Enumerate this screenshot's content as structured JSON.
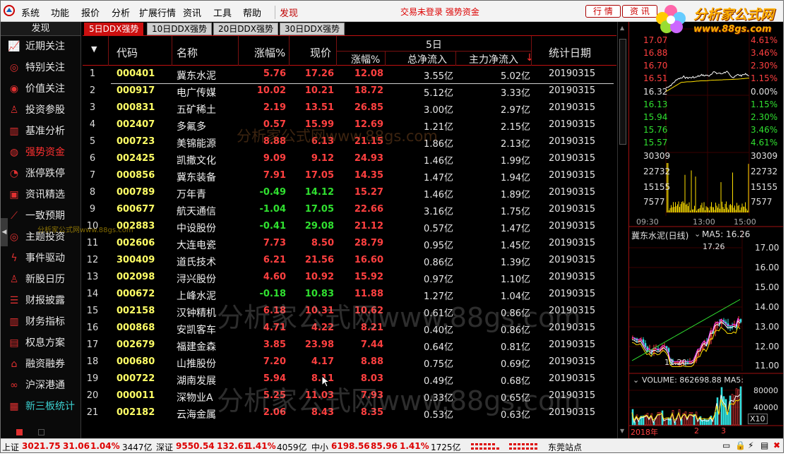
{
  "menubar": {
    "items": [
      "系统",
      "功能",
      "报价",
      "分析",
      "扩展行情",
      "资讯",
      "工具",
      "帮助"
    ],
    "discover": "发现",
    "status": "交易未登录  强势资金",
    "btn_quotes": "行 情",
    "btn_news": "资 讯",
    "logo_line1": "分析家公式网",
    "logo_line2": "www.88gs.com"
  },
  "sidebar": {
    "header": "发现",
    "items": [
      {
        "label": "近期关注",
        "icon": "trend-icon"
      },
      {
        "label": "特别关注",
        "icon": "target-icon"
      },
      {
        "label": "价值关注",
        "icon": "coins-icon"
      },
      {
        "label": "投资参股",
        "icon": "person-icon"
      },
      {
        "label": "基准分析",
        "icon": "bar-chart-icon"
      },
      {
        "label": "强势资金",
        "icon": "money-icon"
      },
      {
        "label": "涨停跌停",
        "icon": "pie-icon"
      },
      {
        "label": "资讯精选",
        "icon": "news-icon"
      },
      {
        "label": "一致预期",
        "icon": "line-chart-icon"
      },
      {
        "label": "主题投资",
        "icon": "target-icon"
      },
      {
        "label": "事件驱动",
        "icon": "lightning-icon"
      },
      {
        "label": "新股日历",
        "icon": "person-icon"
      },
      {
        "label": "财报披露",
        "icon": "stack-icon"
      },
      {
        "label": "财务指标",
        "icon": "bar-chart-icon"
      },
      {
        "label": "权息方案",
        "icon": "doc-icon"
      },
      {
        "label": "融资融券",
        "icon": "bank-icon"
      },
      {
        "label": "沪深港通",
        "icon": "link-icon"
      },
      {
        "label": "新三板统计",
        "icon": "board-icon"
      }
    ]
  },
  "tabs": [
    "5日DDX强势",
    "10日DDX强势",
    "20日DDX强势",
    "30日DDX强势"
  ],
  "table": {
    "headers": {
      "code": "代码",
      "name": "名称",
      "chg": "涨幅%",
      "price": "现价",
      "group": "5日",
      "chg5": "涨幅%",
      "net": "总净流入",
      "main": "主力净流入",
      "date": "统计日期"
    },
    "rows": [
      [
        "1",
        "000401",
        "冀东水泥",
        "5.76",
        "17.26",
        "12.08",
        "3.55亿",
        "5.02亿",
        "20190315"
      ],
      [
        "2",
        "000917",
        "电广传媒",
        "10.02",
        "10.21",
        "18.72",
        "5.12亿",
        "3.33亿",
        "20190315"
      ],
      [
        "3",
        "000831",
        "五矿稀土",
        "2.19",
        "13.51",
        "26.85",
        "3.00亿",
        "2.97亿",
        "20190315"
      ],
      [
        "4",
        "002407",
        "多氟多",
        "0.57",
        "15.99",
        "12.69",
        "1.21亿",
        "2.15亿",
        "20190315"
      ],
      [
        "5",
        "000723",
        "美锦能源",
        "8.88",
        "6.13",
        "21.15",
        "1.86亿",
        "2.13亿",
        "20190315"
      ],
      [
        "6",
        "002425",
        "凯撒文化",
        "9.09",
        "9.12",
        "24.93",
        "1.46亿",
        "1.99亿",
        "20190315"
      ],
      [
        "7",
        "000856",
        "冀东装备",
        "7.91",
        "17.05",
        "14.35",
        "1.47亿",
        "1.94亿",
        "20190315"
      ],
      [
        "8",
        "000789",
        "万年青",
        "-0.49",
        "14.12",
        "15.27",
        "1.46亿",
        "1.89亿",
        "20190315"
      ],
      [
        "9",
        "600677",
        "航天通信",
        "-1.04",
        "17.05",
        "22.66",
        "3.16亿",
        "1.75亿",
        "20190315"
      ],
      [
        "10",
        "002883",
        "中设股份",
        "-0.41",
        "29.08",
        "21.12",
        "0.57亿",
        "1.47亿",
        "20190315"
      ],
      [
        "11",
        "002606",
        "大连电瓷",
        "7.73",
        "8.50",
        "28.79",
        "0.95亿",
        "1.45亿",
        "20190315"
      ],
      [
        "12",
        "300409",
        "道氏技术",
        "6.21",
        "21.56",
        "16.60",
        "0.86亿",
        "1.39亿",
        "20190315"
      ],
      [
        "13",
        "002098",
        "浔兴股份",
        "4.60",
        "10.92",
        "15.92",
        "0.97亿",
        "1.10亿",
        "20190315"
      ],
      [
        "14",
        "000672",
        "上峰水泥",
        "-0.18",
        "10.83",
        "11.88",
        "1.27亿",
        "1.04亿",
        "20190315"
      ],
      [
        "15",
        "002158",
        "汉钟精机",
        "6.18",
        "10.31",
        "10.62",
        "0.61亿",
        "0.86亿",
        "20190315"
      ],
      [
        "16",
        "000868",
        "安凯客车",
        "4.71",
        "4.22",
        "8.21",
        "0.40亿",
        "0.86亿",
        "20190315"
      ],
      [
        "17",
        "002679",
        "福建金森",
        "3.85",
        "23.98",
        "7.44",
        "0.64亿",
        "0.81亿",
        "20190315"
      ],
      [
        "18",
        "000680",
        "山推股份",
        "7.20",
        "4.17",
        "8.88",
        "0.75亿",
        "0.69亿",
        "20190315"
      ],
      [
        "19",
        "000722",
        "湖南发展",
        "5.94",
        "8.11",
        "8.03",
        "0.49亿",
        "0.68亿",
        "20190315"
      ],
      [
        "20",
        "000011",
        "深物业A",
        "5.25",
        "11.03",
        "7.93",
        "0.33亿",
        "0.65亿",
        "20190315"
      ],
      [
        "21",
        "002182",
        "云海金属",
        "2.06",
        "8.43",
        "8.35",
        "0.53亿",
        "0.63亿",
        "20190315"
      ]
    ]
  },
  "watermark": "分析家公式网www.88gs.com",
  "watermark_big": "分析家公式网www.88gs.com",
  "watermark_small": "分析家公式网www.88gs.com",
  "intraday": {
    "price_labels": [
      "17.07",
      "16.88",
      "16.70",
      "16.51",
      "16.32",
      "16.13",
      "15.94",
      "15.76",
      "15.57"
    ],
    "pct_labels": [
      "4.61%",
      "3.46%",
      "2.30%",
      "1.15%",
      "0.00%",
      "1.15%",
      "2.30%",
      "3.46%",
      "4.61%"
    ],
    "vol_labels": [
      "30309",
      "22732",
      "15155",
      "7577"
    ],
    "time_labels": [
      "09:30",
      "13:00",
      "15:00"
    ]
  },
  "kline": {
    "title": "冀东水泥(日线)",
    "ma": "MA5: 16.26",
    "high_label": "17.26",
    "low_label": "11.20",
    "axis": [
      "17.00",
      "16.00",
      "15.00",
      "14.00",
      "13.00",
      "12.00",
      "11.00"
    ]
  },
  "volume": {
    "title": "VOLUME: 862698.88  MA5:",
    "axis": [
      "80000",
      "40000"
    ],
    "unit": "X10",
    "date_labels": [
      "2018年",
      "2",
      "3"
    ]
  },
  "bottombar": {
    "sh_name": "上证",
    "sh_val": "3021.75",
    "sh_chg": "31.06",
    "sh_pct": "1.04%",
    "sh_amt": "3447亿",
    "sz_name": "深证",
    "sz_val": "9550.54",
    "sz_chg": "132.61",
    "sz_pct": "1.41%",
    "sz_amt": "4059亿",
    "zx_name": "中小",
    "zx_val": "6198.56",
    "zx_chg": "85.96",
    "zx_pct": "1.41%",
    "zx_amt": "1725亿",
    "site": "东莞站点"
  },
  "colors": {
    "up": "#ff4040",
    "down": "#30e030",
    "accent": "#cc1010",
    "code": "#ffff66"
  }
}
